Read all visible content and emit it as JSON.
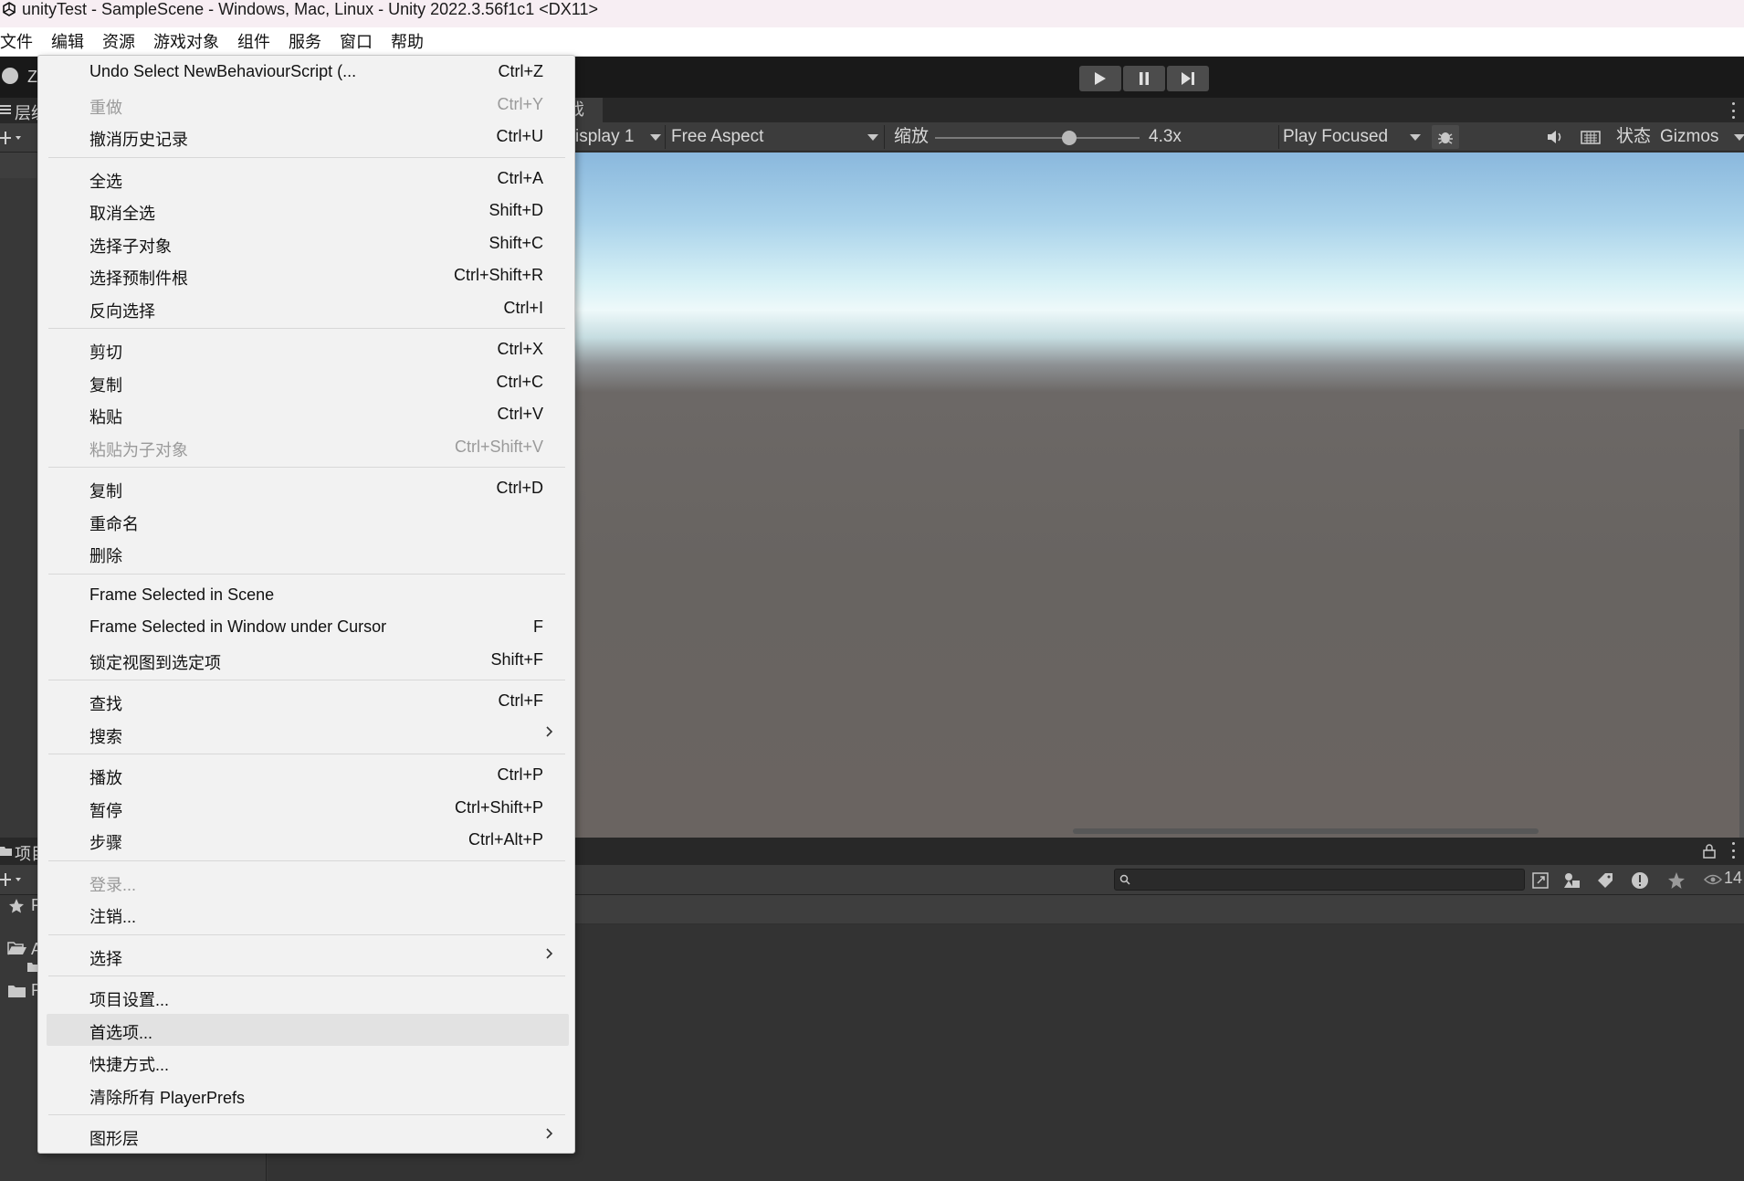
{
  "window": {
    "title": "unityTest - SampleScene - Windows, Mac, Linux - Unity 2022.3.56f1c1 <DX11>"
  },
  "menubar": {
    "items": [
      "文件",
      "编辑",
      "资源",
      "游戏对象",
      "组件",
      "服务",
      "窗口",
      "帮助"
    ]
  },
  "toolbar": {
    "account_letter": "Z"
  },
  "hierarchy": {
    "tab_label": "层级"
  },
  "game_view": {
    "tab_fragment": "戏",
    "display": "isplay 1",
    "aspect": "Free Aspect",
    "scale_label": "缩放",
    "scale_value": "4.3x",
    "play_mode": "Play Focused",
    "stats_label": "状态",
    "gizmos_label": "Gizmos"
  },
  "project": {
    "tab_label": "项目",
    "favorites_letter": "F",
    "assets_letter": "A",
    "packages_letter": "P",
    "hidden_count": "14"
  },
  "edit_menu": {
    "groups": [
      [
        {
          "label": "Undo Select NewBehaviourScript (...",
          "shortcut": "Ctrl+Z",
          "enabled": true
        },
        {
          "label": "重做",
          "shortcut": "Ctrl+Y",
          "enabled": false
        },
        {
          "label": "撤消历史记录",
          "shortcut": "Ctrl+U",
          "enabled": true
        }
      ],
      [
        {
          "label": "全选",
          "shortcut": "Ctrl+A",
          "enabled": true
        },
        {
          "label": "取消全选",
          "shortcut": "Shift+D",
          "enabled": true
        },
        {
          "label": "选择子对象",
          "shortcut": "Shift+C",
          "enabled": true
        },
        {
          "label": "选择预制件根",
          "shortcut": "Ctrl+Shift+R",
          "enabled": true
        },
        {
          "label": "反向选择",
          "shortcut": "Ctrl+I",
          "enabled": true
        }
      ],
      [
        {
          "label": "剪切",
          "shortcut": "Ctrl+X",
          "enabled": true
        },
        {
          "label": "复制",
          "shortcut": "Ctrl+C",
          "enabled": true
        },
        {
          "label": "粘贴",
          "shortcut": "Ctrl+V",
          "enabled": true
        },
        {
          "label": "粘贴为子对象",
          "shortcut": "Ctrl+Shift+V",
          "enabled": false
        }
      ],
      [
        {
          "label": "复制",
          "shortcut": "Ctrl+D",
          "enabled": true
        },
        {
          "label": "重命名",
          "shortcut": "",
          "enabled": true
        },
        {
          "label": "删除",
          "shortcut": "",
          "enabled": true
        }
      ],
      [
        {
          "label": "Frame Selected in Scene",
          "shortcut": "",
          "enabled": true
        },
        {
          "label": "Frame Selected in Window under Cursor",
          "shortcut": "F",
          "enabled": true
        },
        {
          "label": "锁定视图到选定项",
          "shortcut": "Shift+F",
          "enabled": true
        }
      ],
      [
        {
          "label": "查找",
          "shortcut": "Ctrl+F",
          "enabled": true
        },
        {
          "label": "搜索",
          "shortcut": "",
          "enabled": true,
          "submenu": true
        }
      ],
      [
        {
          "label": "播放",
          "shortcut": "Ctrl+P",
          "enabled": true
        },
        {
          "label": "暂停",
          "shortcut": "Ctrl+Shift+P",
          "enabled": true
        },
        {
          "label": "步骤",
          "shortcut": "Ctrl+Alt+P",
          "enabled": true
        }
      ],
      [
        {
          "label": "登录...",
          "shortcut": "",
          "enabled": false
        },
        {
          "label": "注销...",
          "shortcut": "",
          "enabled": true
        }
      ],
      [
        {
          "label": "选择",
          "shortcut": "",
          "enabled": true,
          "submenu": true
        }
      ],
      [
        {
          "label": "项目设置...",
          "shortcut": "",
          "enabled": true
        },
        {
          "label": "首选项...",
          "shortcut": "",
          "enabled": true,
          "highlighted": true
        },
        {
          "label": "快捷方式...",
          "shortcut": "",
          "enabled": true
        },
        {
          "label": "清除所有 PlayerPrefs",
          "shortcut": "",
          "enabled": true
        }
      ],
      [
        {
          "label": "图形层",
          "shortcut": "",
          "enabled": true,
          "submenu": true
        }
      ]
    ]
  }
}
